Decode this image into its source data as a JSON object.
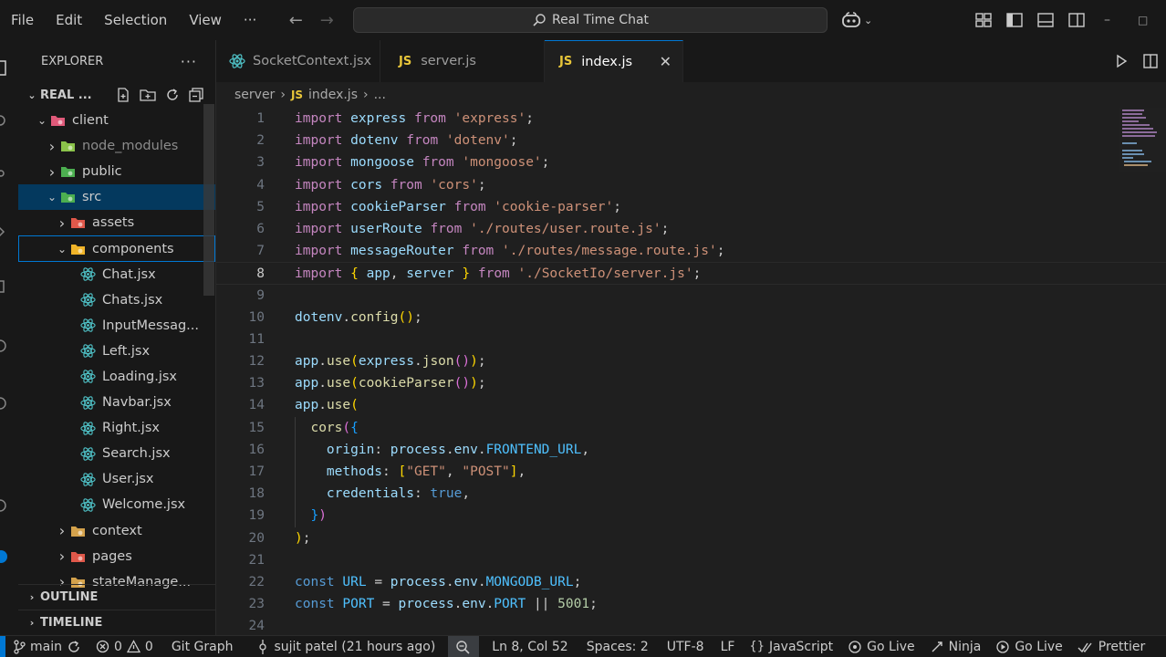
{
  "menu": [
    "File",
    "Edit",
    "Selection",
    "View"
  ],
  "menu_more": "···",
  "search": {
    "title": "Real Time Chat"
  },
  "explorer": {
    "header": "EXPLORER",
    "more": "···",
    "project": "REAL ...",
    "tree": [
      {
        "label": "client",
        "depth": 1,
        "expanded": true,
        "kind": "folder",
        "icon": "client-folder-icon",
        "color": "#e05a7a"
      },
      {
        "label": "node_modules",
        "depth": 2,
        "expanded": false,
        "kind": "folder",
        "icon": "node-folder-icon",
        "color": "#8bc34a",
        "dim": true
      },
      {
        "label": "public",
        "depth": 2,
        "expanded": false,
        "kind": "folder",
        "icon": "public-folder-icon",
        "color": "#4caf50"
      },
      {
        "label": "src",
        "depth": 2,
        "expanded": true,
        "kind": "folder",
        "icon": "src-folder-icon",
        "color": "#4caf50",
        "selected": true
      },
      {
        "label": "assets",
        "depth": 3,
        "expanded": false,
        "kind": "folder",
        "icon": "assets-folder-icon",
        "color": "#e0584a"
      },
      {
        "label": "components",
        "depth": 3,
        "expanded": true,
        "kind": "folder",
        "icon": "components-folder-icon",
        "color": "#f0b429",
        "focused": true
      },
      {
        "label": "Chat.jsx",
        "depth": 4,
        "kind": "file",
        "icon": "react-icon",
        "color": "#4fc1c6"
      },
      {
        "label": "Chats.jsx",
        "depth": 4,
        "kind": "file",
        "icon": "react-icon",
        "color": "#4fc1c6"
      },
      {
        "label": "InputMessag...",
        "depth": 4,
        "kind": "file",
        "icon": "react-icon",
        "color": "#4fc1c6"
      },
      {
        "label": "Left.jsx",
        "depth": 4,
        "kind": "file",
        "icon": "react-icon",
        "color": "#4fc1c6"
      },
      {
        "label": "Loading.jsx",
        "depth": 4,
        "kind": "file",
        "icon": "react-icon",
        "color": "#4fc1c6"
      },
      {
        "label": "Navbar.jsx",
        "depth": 4,
        "kind": "file",
        "icon": "react-icon",
        "color": "#4fc1c6"
      },
      {
        "label": "Right.jsx",
        "depth": 4,
        "kind": "file",
        "icon": "react-icon",
        "color": "#4fc1c6"
      },
      {
        "label": "Search.jsx",
        "depth": 4,
        "kind": "file",
        "icon": "react-icon",
        "color": "#4fc1c6"
      },
      {
        "label": "User.jsx",
        "depth": 4,
        "kind": "file",
        "icon": "react-icon",
        "color": "#4fc1c6"
      },
      {
        "label": "Welcome.jsx",
        "depth": 4,
        "kind": "file",
        "icon": "react-icon",
        "color": "#4fc1c6"
      },
      {
        "label": "context",
        "depth": 3,
        "expanded": false,
        "kind": "folder",
        "icon": "context-folder-icon",
        "color": "#d4a24c"
      },
      {
        "label": "pages",
        "depth": 3,
        "expanded": false,
        "kind": "folder",
        "icon": "pages-folder-icon",
        "color": "#e0584a"
      },
      {
        "label": "stateManage...",
        "depth": 3,
        "expanded": false,
        "kind": "folder",
        "icon": "state-folder-icon",
        "color": "#d4a24c"
      }
    ],
    "outline": "OUTLINE",
    "timeline": "TIMELINE"
  },
  "tabs": [
    {
      "label": "SocketContext.jsx",
      "icon": "react-icon",
      "active": false
    },
    {
      "label": "server.js",
      "icon": "js-icon",
      "badge": "JS",
      "active": false
    },
    {
      "label": "index.js",
      "icon": "js-icon",
      "badge": "JS",
      "active": true
    }
  ],
  "breadcrumb": {
    "folder": "server",
    "badge": "JS",
    "file": "index.js",
    "more": "..."
  },
  "code": {
    "current_line": 8,
    "lines": [
      [
        [
          "kw",
          "import"
        ],
        [
          "pun",
          " "
        ],
        [
          "id",
          "express"
        ],
        [
          "pun",
          " "
        ],
        [
          "kw",
          "from"
        ],
        [
          "pun",
          " "
        ],
        [
          "str",
          "'express'"
        ],
        [
          "pun",
          ";"
        ]
      ],
      [
        [
          "kw",
          "import"
        ],
        [
          "pun",
          " "
        ],
        [
          "id",
          "dotenv"
        ],
        [
          "pun",
          " "
        ],
        [
          "kw",
          "from"
        ],
        [
          "pun",
          " "
        ],
        [
          "str",
          "'dotenv'"
        ],
        [
          "pun",
          ";"
        ]
      ],
      [
        [
          "kw",
          "import"
        ],
        [
          "pun",
          " "
        ],
        [
          "id",
          "mongoose"
        ],
        [
          "pun",
          " "
        ],
        [
          "kw",
          "from"
        ],
        [
          "pun",
          " "
        ],
        [
          "str",
          "'mongoose'"
        ],
        [
          "pun",
          ";"
        ]
      ],
      [
        [
          "kw",
          "import"
        ],
        [
          "pun",
          " "
        ],
        [
          "id",
          "cors"
        ],
        [
          "pun",
          " "
        ],
        [
          "kw",
          "from"
        ],
        [
          "pun",
          " "
        ],
        [
          "str",
          "'cors'"
        ],
        [
          "pun",
          ";"
        ]
      ],
      [
        [
          "kw",
          "import"
        ],
        [
          "pun",
          " "
        ],
        [
          "id",
          "cookieParser"
        ],
        [
          "pun",
          " "
        ],
        [
          "kw",
          "from"
        ],
        [
          "pun",
          " "
        ],
        [
          "str",
          "'cookie-parser'"
        ],
        [
          "pun",
          ";"
        ]
      ],
      [
        [
          "kw",
          "import"
        ],
        [
          "pun",
          " "
        ],
        [
          "id",
          "userRoute"
        ],
        [
          "pun",
          " "
        ],
        [
          "kw",
          "from"
        ],
        [
          "pun",
          " "
        ],
        [
          "str",
          "'./routes/user.route.js'"
        ],
        [
          "pun",
          ";"
        ]
      ],
      [
        [
          "kw",
          "import"
        ],
        [
          "pun",
          " "
        ],
        [
          "id",
          "messageRouter"
        ],
        [
          "pun",
          " "
        ],
        [
          "kw",
          "from"
        ],
        [
          "pun",
          " "
        ],
        [
          "str",
          "'./routes/message.route.js'"
        ],
        [
          "pun",
          ";"
        ]
      ],
      [
        [
          "kw",
          "import"
        ],
        [
          "pun",
          " "
        ],
        [
          "br1",
          "{"
        ],
        [
          "pun",
          " "
        ],
        [
          "id",
          "app"
        ],
        [
          "pun",
          ", "
        ],
        [
          "id",
          "server"
        ],
        [
          "pun",
          " "
        ],
        [
          "br1",
          "}"
        ],
        [
          "pun",
          " "
        ],
        [
          "kw",
          "from"
        ],
        [
          "pun",
          " "
        ],
        [
          "str",
          "'./SocketIo/server.js'"
        ],
        [
          "pun",
          ";"
        ]
      ],
      [],
      [
        [
          "id",
          "dotenv"
        ],
        [
          "pun",
          "."
        ],
        [
          "fn",
          "config"
        ],
        [
          "br1",
          "()"
        ],
        [
          "pun",
          ";"
        ]
      ],
      [],
      [
        [
          "id",
          "app"
        ],
        [
          "pun",
          "."
        ],
        [
          "fn",
          "use"
        ],
        [
          "br1",
          "("
        ],
        [
          "id",
          "express"
        ],
        [
          "pun",
          "."
        ],
        [
          "fn",
          "json"
        ],
        [
          "br2",
          "()"
        ],
        [
          "br1",
          ")"
        ],
        [
          "pun",
          ";"
        ]
      ],
      [
        [
          "id",
          "app"
        ],
        [
          "pun",
          "."
        ],
        [
          "fn",
          "use"
        ],
        [
          "br1",
          "("
        ],
        [
          "fn",
          "cookieParser"
        ],
        [
          "br2",
          "()"
        ],
        [
          "br1",
          ")"
        ],
        [
          "pun",
          ";"
        ]
      ],
      [
        [
          "id",
          "app"
        ],
        [
          "pun",
          "."
        ],
        [
          "fn",
          "use"
        ],
        [
          "br1",
          "("
        ]
      ],
      [
        [
          "pun",
          "  "
        ],
        [
          "fn",
          "cors"
        ],
        [
          "br2",
          "("
        ],
        [
          "br3",
          "{"
        ]
      ],
      [
        [
          "pun",
          "    "
        ],
        [
          "id",
          "origin"
        ],
        [
          "pun",
          ": "
        ],
        [
          "id",
          "process"
        ],
        [
          "pun",
          "."
        ],
        [
          "id",
          "env"
        ],
        [
          "pun",
          "."
        ],
        [
          "cn",
          "FRONTEND_URL"
        ],
        [
          "pun",
          ","
        ]
      ],
      [
        [
          "pun",
          "    "
        ],
        [
          "id",
          "methods"
        ],
        [
          "pun",
          ": "
        ],
        [
          "br1",
          "["
        ],
        [
          "str",
          "\"GET\""
        ],
        [
          "pun",
          ", "
        ],
        [
          "str",
          "\"POST\""
        ],
        [
          "br1",
          "]"
        ],
        [
          "pun",
          ","
        ]
      ],
      [
        [
          "pun",
          "    "
        ],
        [
          "id",
          "credentials"
        ],
        [
          "pun",
          ": "
        ],
        [
          "kb",
          "true"
        ],
        [
          "pun",
          ","
        ]
      ],
      [
        [
          "pun",
          "  "
        ],
        [
          "br3",
          "}"
        ],
        [
          "br2",
          ")"
        ]
      ],
      [
        [
          "br1",
          ")"
        ],
        [
          "pun",
          ";"
        ]
      ],
      [],
      [
        [
          "kb",
          "const"
        ],
        [
          "pun",
          " "
        ],
        [
          "cn",
          "URL"
        ],
        [
          "pun",
          " = "
        ],
        [
          "id",
          "process"
        ],
        [
          "pun",
          "."
        ],
        [
          "id",
          "env"
        ],
        [
          "pun",
          "."
        ],
        [
          "cn",
          "MONGODB_URL"
        ],
        [
          "pun",
          ";"
        ]
      ],
      [
        [
          "kb",
          "const"
        ],
        [
          "pun",
          " "
        ],
        [
          "cn",
          "PORT"
        ],
        [
          "pun",
          " = "
        ],
        [
          "id",
          "process"
        ],
        [
          "pun",
          "."
        ],
        [
          "id",
          "env"
        ],
        [
          "pun",
          "."
        ],
        [
          "cn",
          "PORT"
        ],
        [
          "pun",
          " || "
        ],
        [
          "num",
          "5001"
        ],
        [
          "pun",
          ";"
        ]
      ],
      []
    ]
  },
  "status": {
    "branch": "main",
    "errors": "0",
    "warnings": "0",
    "git_graph": "Git Graph",
    "blame": "sujit patel (21 hours ago)",
    "position": "Ln 8, Col 52",
    "spaces": "Spaces: 2",
    "encoding": "UTF-8",
    "eol": "LF",
    "language": "JavaScript",
    "go_live_1": "Go Live",
    "ninja": "Ninja",
    "go_live_2": "Go Live",
    "prettier": "Prettier"
  },
  "colors": {
    "accent": "#0078d4",
    "js_badge": "#e8c63a",
    "react": "#4fc1c6"
  }
}
